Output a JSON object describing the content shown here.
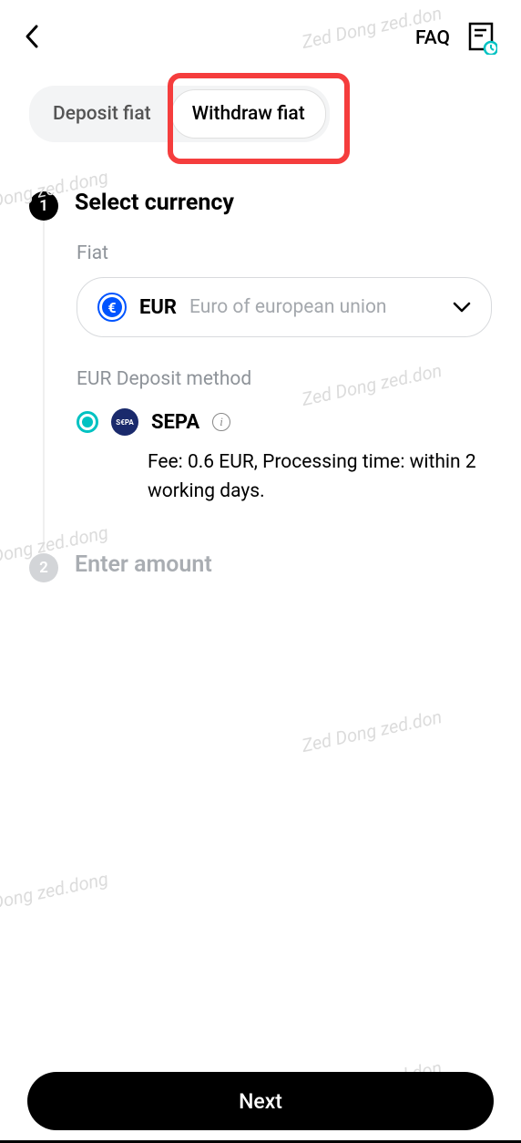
{
  "header": {
    "faq": "FAQ"
  },
  "tabs": {
    "deposit": "Deposit fiat",
    "withdraw": "Withdraw fiat"
  },
  "step1": {
    "number": "1",
    "title": "Select currency",
    "fiat_label": "Fiat",
    "currency_code": "EUR",
    "currency_name": "Euro of european union",
    "method_label": "EUR Deposit method",
    "method_badge": "S€PA",
    "method_name": "SEPA",
    "method_desc": "Fee: 0.6 EUR, Processing time: within 2 working days."
  },
  "step2": {
    "number": "2",
    "title": "Enter amount"
  },
  "footer": {
    "next": "Next"
  },
  "watermarks": {
    "w1": "Zed Dong zed.don",
    "w2": "Dong zed.dong",
    "w3": "Zed Dong zed.don",
    "w4": "Dong zed.dong",
    "w5": "Zed Dong zed.don",
    "w6": "Dong zed.dong",
    "w7": "Zed Dong zed.don"
  }
}
